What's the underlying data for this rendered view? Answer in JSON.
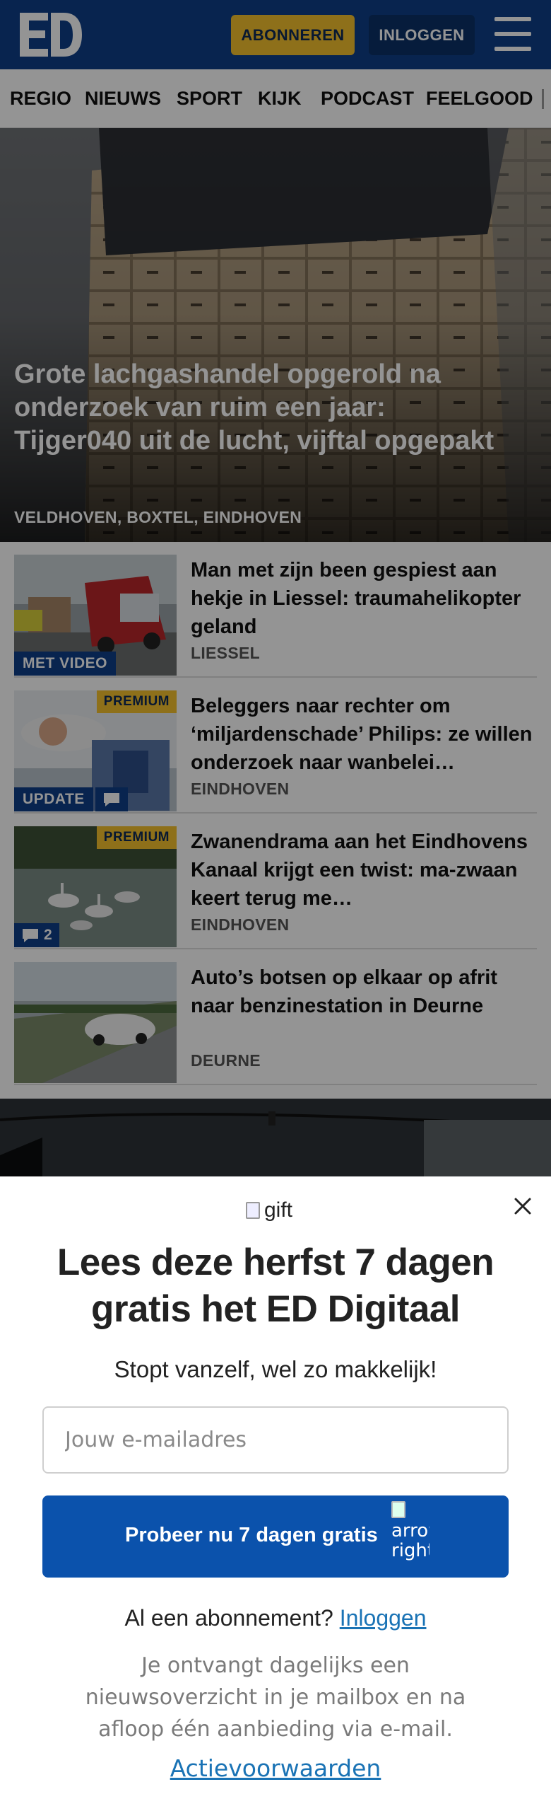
{
  "header": {
    "logo_text": "ED",
    "subscribe_label": "ABONNEREN",
    "login_label": "INLOGGEN",
    "menu_icon": "hamburger-menu-icon",
    "brand_color": "#0e3f88",
    "accent_color": "#f5c12e"
  },
  "nav": {
    "items": [
      "REGIO",
      "NIEUWS",
      "SPORT",
      "KIJK",
      "PODCAST",
      "FEELGOOD"
    ]
  },
  "hero": {
    "title": "Grote lachgashandel opgerold na onderzoek van ruim een jaar: Tijger040 uit de lucht, vijftal opgepakt",
    "location": "VELDHOVEN, BOXTEL, EINDHOVEN"
  },
  "articles": [
    {
      "title": "Man met zijn been gespiest aan hekje in Liessel: traumahelikop­ter geland",
      "location": "LIESSEL",
      "badge": "MET VIDEO"
    },
    {
      "title": "Beleggers naar rechter om ‘miljardenschade’ Philips: ze willen onderzoek naar wanbelei…",
      "location": "EINDHOVEN",
      "badge": "UPDATE",
      "premium": "PREMIUM"
    },
    {
      "title": "Zwanendrama aan het Eindhovens Kanaal krijgt een twist: ma-zwaan keert terug me…",
      "location": "EINDHOVEN",
      "premium": "PREMIUM",
      "comments": "2"
    },
    {
      "title": "Auto’s botsen op elkaar op afrit naar benzinestation in Deurne",
      "location": "DEURNE"
    }
  ],
  "modal": {
    "gift_alt": "gift",
    "title": "Lees deze herfst 7 dagen gratis het ED Digitaal",
    "subtitle": "Stopt vanzelf, wel zo makkelijk!",
    "email_placeholder": "Jouw e-mailadres",
    "cta_label": "Probeer nu 7 dagen gratis",
    "cta_icon_alt": "arrow right",
    "have_subscription": "Al een abonnement?",
    "login_link": "Inloggen",
    "info": "Je ontvangt dagelijks een nieuwsoverzicht in je mailbox en na afloop één aanbieding via e-mail.",
    "terms_link": "Actievoorwaarden",
    "button_color": "#0b52ac",
    "link_color": "#1a73b5"
  }
}
